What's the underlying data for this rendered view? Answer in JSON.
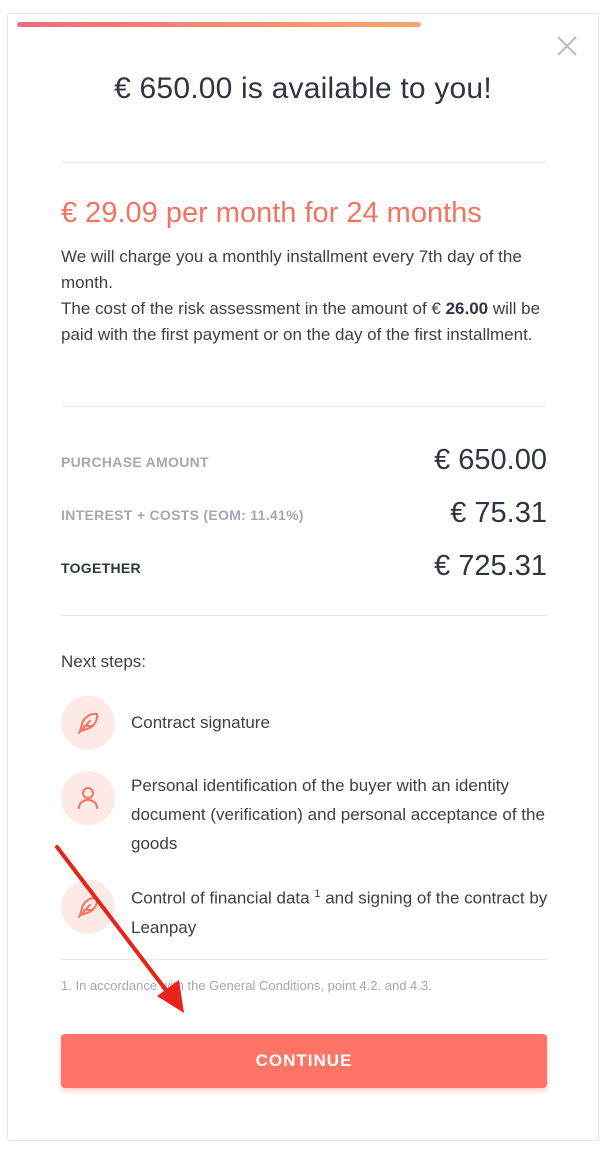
{
  "title": "€ 650.00 is available to you!",
  "headline": "€ 29.09 per month for 24 months",
  "description": {
    "line1": "We will charge you a monthly installment every 7th day of the month.",
    "line2_prefix": "The cost of the risk assessment in the amount of € ",
    "line2_amount": "26.00",
    "line2_suffix": " will be paid with the first payment or on the day of the first installment."
  },
  "summary": [
    {
      "label": "PURCHASE AMOUNT",
      "amount": "€ 650.00"
    },
    {
      "label": "INTEREST + COSTS (EOM: 11.41%)",
      "amount": "€ 75.31"
    },
    {
      "label": "TOGETHER",
      "amount": "€ 725.31"
    }
  ],
  "next_steps": {
    "label": "Next steps:",
    "items": [
      {
        "icon": "feather-icon",
        "text": "Contract signature"
      },
      {
        "icon": "person-icon",
        "text": "Personal identification of the buyer with an identity document (verification) and personal acceptance of the goods"
      },
      {
        "icon": "feather-icon",
        "text_prefix": "Control of financial data ",
        "sup": "1",
        "text_suffix": " and signing of the contract by Leanpay"
      }
    ]
  },
  "footnote": "1. In accordance with the General Conditions, point 4.2. and 4.3.",
  "continue_label": "CONTINUE",
  "colors": {
    "accent": "#ff7466",
    "headline": "#f27460",
    "progress_start": "#f06b7a",
    "progress_end": "#f7a86a",
    "annotation_arrow": "#e8231a"
  }
}
